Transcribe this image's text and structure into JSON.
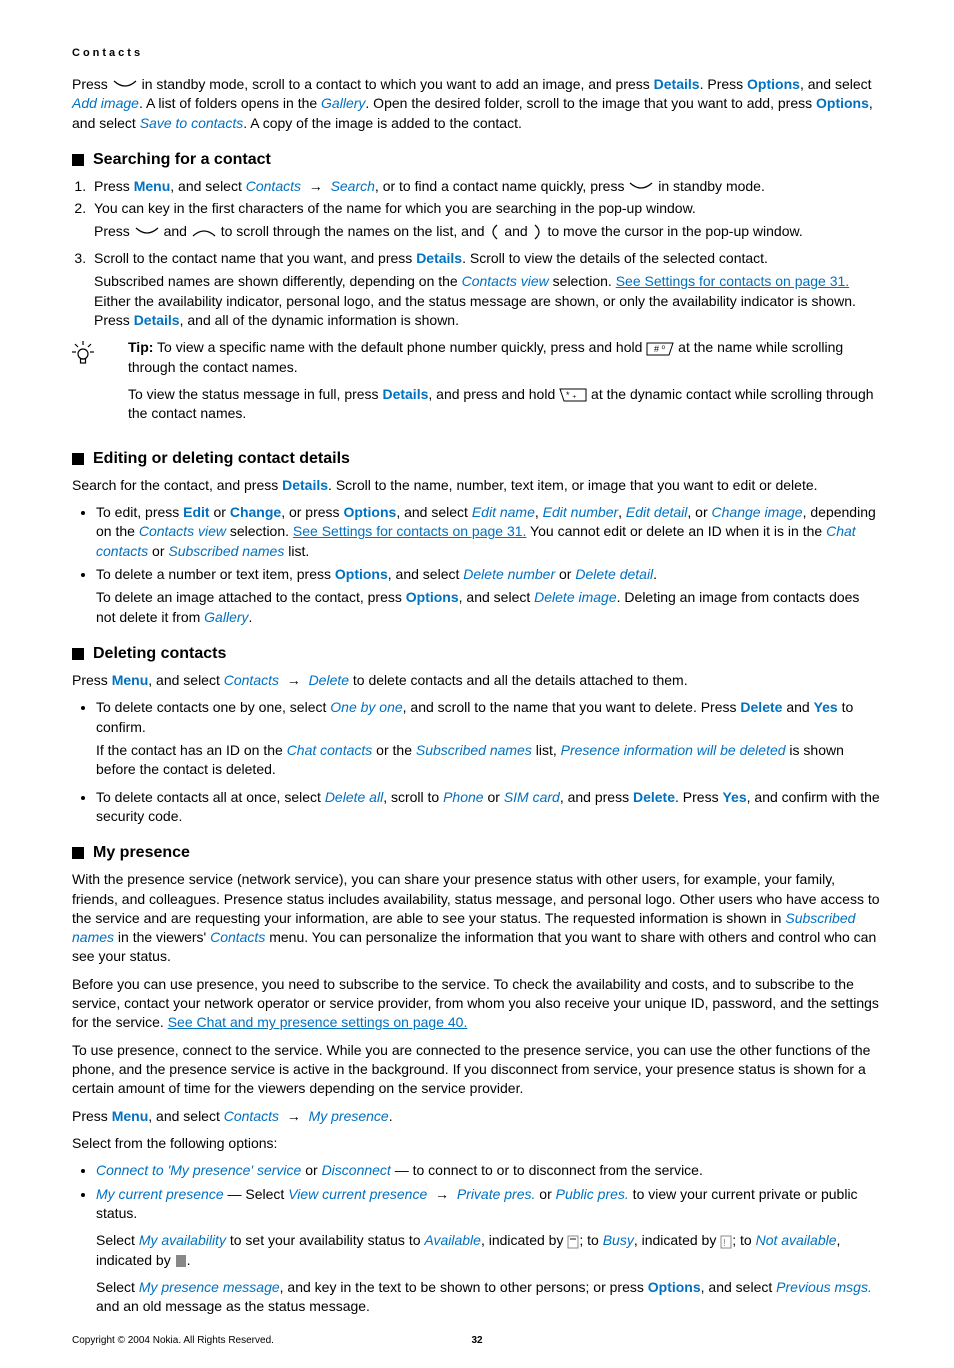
{
  "header": "Contacts",
  "intro": {
    "p1a": "Press ",
    "p1b": " in standby mode, scroll to a contact to which you want to add an image, and press ",
    "details": "Details",
    "p1c": ". Press ",
    "options": "Options",
    "p1d": ", and select ",
    "add_image": "Add image",
    "p1e": ". A list of folders opens in the ",
    "gallery": "Gallery",
    "p1f": ". Open the desired folder, scroll to the image that you want to add, press ",
    "p1g": ", and select ",
    "save_to_contacts": "Save to contacts",
    "p1h": ". A copy of the image is added to the contact."
  },
  "s1": {
    "title": "Searching for a contact",
    "li1a": "Press ",
    "menu": "Menu",
    "li1b": ", and select ",
    "contacts": "Contacts",
    "search": "Search",
    "li1c": ", or to find a contact name quickly, press ",
    "li1d": " in standby mode.",
    "li2": "You can key in the first characters of the name for which you are searching in the pop-up window.",
    "li2sub_a": "Press ",
    "li2sub_b": " and ",
    "li2sub_c": " to scroll through the names on the list, and ",
    "li2sub_d": " and ",
    "li2sub_e": " to move the cursor in the pop-up window.",
    "li3a": "Scroll to the contact name that you want, and press ",
    "details": "Details",
    "li3b": ". Scroll to view the details of the selected contact.",
    "li3sub_a": "Subscribed names are shown differently, depending on the ",
    "contacts_view": "Contacts view",
    "li3sub_b": " selection. ",
    "see_settings": "See Settings for contacts on page 31.",
    "li3sub_c": " Either the availability indicator, personal logo, and the status message are shown, or only the availability indicator is shown. Press ",
    "li3sub_d": ", and all of the dynamic information is shown.",
    "tip_label": "Tip:",
    "tip1a": " To view a specific name with the default phone number quickly, press and hold ",
    "tip1b": " at the name while scrolling through the contact names.",
    "tip2a": "To view the status message in full, press ",
    "tip2b": ", and press and hold ",
    "tip2c": " at the dynamic contact while scrolling through the contact names."
  },
  "s2": {
    "title": "Editing or deleting contact details",
    "p1a": "Search for the contact, and press ",
    "details": "Details",
    "p1b": ". Scroll to the name, number, text item, or image that you want to edit or delete.",
    "b1a": "To edit, press ",
    "edit": "Edit",
    "or": " or ",
    "change": "Change",
    "b1b": ", or press ",
    "options": "Options",
    "b1c": ", and select ",
    "edit_name": "Edit name",
    "comma": ", ",
    "edit_number": "Edit number",
    "edit_detail": "Edit detail",
    "b1d": ", or ",
    "change_image": "Change image",
    "b1e": ", depending on the ",
    "contacts_view": "Contacts view",
    "b1f": " selection. ",
    "see_settings": "See Settings for contacts on page 31.",
    "b1g": " You cannot edit or delete an ID when it is in the ",
    "chat_contacts": "Chat contacts",
    "b1h": " or ",
    "subscribed_names": "Subscribed names",
    "b1i": " list.",
    "b2a": "To delete a number or text item, press ",
    "b2b": ", and select ",
    "delete_number": "Delete number",
    "b2c": " or ",
    "delete_detail": "Delete detail",
    "b2d": ".",
    "b2e": "To delete an image attached to the contact, press ",
    "b2f": ", and select ",
    "delete_image": "Delete image",
    "b2g": ". Deleting an image from contacts does not delete it from ",
    "gallery": "Gallery",
    "b2h": "."
  },
  "s3": {
    "title": "Deleting contacts",
    "p1a": "Press ",
    "menu": "Menu",
    "p1b": ", and select ",
    "contacts": "Contacts",
    "delete": "Delete",
    "p1c": " to delete contacts and all the details attached to them.",
    "b1a": "To delete contacts one by one, select ",
    "one_by_one": "One by one",
    "b1b": ", and scroll to the name that you want to delete. Press ",
    "delete_b": "Delete",
    "and": " and ",
    "yes": "Yes",
    "b1c": " to confirm.",
    "b1d": "If the contact has an ID on the ",
    "chat_contacts": "Chat contacts",
    "b1e": " or the ",
    "subscribed_names": "Subscribed names",
    "b1f": " list, ",
    "presence_info": "Presence information will be deleted",
    "b1g": " is shown before the contact is deleted.",
    "b2a": "To delete contacts all at once, select ",
    "delete_all": "Delete all",
    "b2b": ", scroll to ",
    "phone": "Phone",
    "or": " or ",
    "sim_card": "SIM card",
    "b2c": ", and press ",
    "b2d": ". Press ",
    "b2e": ", and confirm with the security code."
  },
  "s4": {
    "title": "My presence",
    "p1": "With the presence service (network service), you can share your presence status with other users, for example, your family, friends, and colleagues. Presence status includes availability, status message, and personal logo. Other users who have access to the service and are requesting your information, are able to see your status. The requested information is shown in ",
    "subscribed_names": "Subscribed names",
    "p1b": " in the viewers' ",
    "contacts": "Contacts",
    "p1c": " menu. You can personalize the information that you want to share with others and control who can see your status.",
    "p2": "Before you can use presence, you need to subscribe to the service. To check the availability and costs, and to subscribe to the service, contact your network operator or service provider, from whom you also receive your unique ID, password, and the settings for the service. ",
    "see_chat": "See Chat and my presence settings on page 40.",
    "p3": "To use presence, connect to the service. While you are connected to the presence service, you can use the other functions of the phone, and the presence service is active in the background. If you disconnect from service, your presence status is shown for a certain amount of time for the viewers depending on the service provider.",
    "p4a": "Press ",
    "menu": "Menu",
    "p4b": ", and select ",
    "my_presence": "My presence",
    "p4c": ".",
    "p5": "Select from the following options:",
    "b1a": "Connect to 'My presence' service",
    "b1b": " or ",
    "disconnect": "Disconnect",
    "b1c": " — to connect to or to disconnect from the service.",
    "b2a": "My current presence",
    "b2b": " — Select ",
    "view_current": "View current presence",
    "private_pres": "Private pres.",
    "b2c": " or ",
    "public_pres": "Public pres.",
    "b2d": " to view your current private or public status.",
    "b2e": "Select ",
    "my_availability": "My availability",
    "b2f": " to set your availability status to ",
    "available": "Available",
    "b2g": ", indicated by ",
    "b2h": "; to ",
    "busy": "Busy",
    "b2i": ", indicated by ",
    "b2j": "; to ",
    "not_available": "Not available",
    "b2k": ", indicated by ",
    "b2l": ".",
    "b2m": "Select ",
    "my_pres_msg": "My presence message",
    "b2n": ", and key in the text to be shown to other persons; or press ",
    "options": "Options",
    "b2o": ", and select ",
    "previous_msgs": "Previous msgs.",
    "b2p": " and an old message as the status message."
  },
  "footer": {
    "copyright": "Copyright © 2004 Nokia. All Rights Reserved.",
    "page": "32"
  }
}
